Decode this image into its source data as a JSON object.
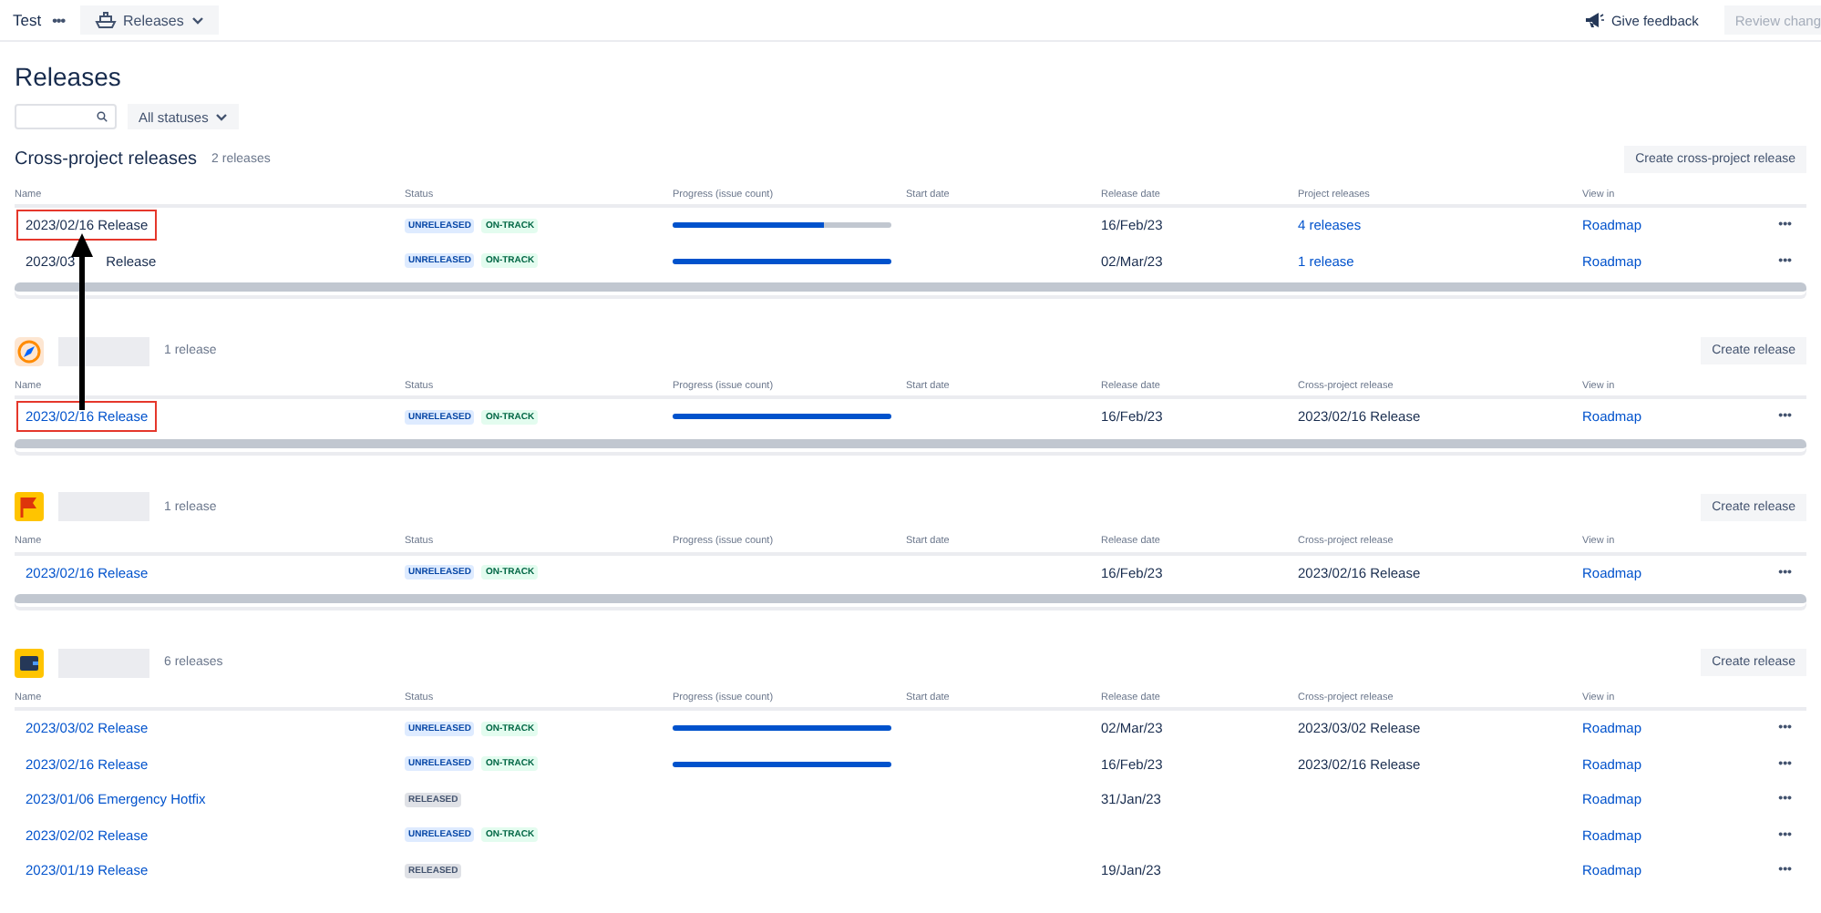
{
  "top_bar": {
    "project": "Test",
    "more": "•••",
    "nav_button": "Releases",
    "feedback": "Give feedback",
    "review_button": {
      "label": "Review chang",
      "disabled": true
    }
  },
  "title": "Releases",
  "filters": {
    "status_dropdown": "All statuses"
  },
  "sections": [
    {
      "kind": "cross_project",
      "heading": "Cross-project releases",
      "count": "2 releases",
      "button": "Create cross-project release",
      "scrollbar": true,
      "columns": [
        "Name",
        "Status",
        "Progress (issue count)",
        "Start date",
        "Release date",
        "Project releases",
        "View in"
      ],
      "rows": [
        {
          "name": "2023/02/16 Release",
          "link": false,
          "highlighted": true,
          "lozenges": [
            {
              "text": "UNRELEASED",
              "kind": "unreleased"
            },
            {
              "text": "ON-TRACK",
              "kind": "ontrack"
            }
          ],
          "progress": {
            "level": 0.69
          },
          "release_date": "16/Feb/23",
          "column_6": {
            "text": "4 releases",
            "link": true
          },
          "view_in": "Roadmap",
          "more": "•••"
        },
        {
          "name_fragments": [
            "2023/03",
            "Release"
          ],
          "link": false,
          "highlighted": false,
          "lozenges": [
            {
              "text": "UNRELEASED",
              "kind": "unreleased"
            },
            {
              "text": "ON-TRACK",
              "kind": "ontrack"
            }
          ],
          "progress": {
            "level": 1
          },
          "release_date": "02/Mar/23",
          "column_6": {
            "text": "1 release",
            "link": true
          },
          "view_in": "Roadmap",
          "more": "•••"
        }
      ]
    },
    {
      "kind": "project",
      "count": "1 release",
      "button": "Create release",
      "scrollbar": true,
      "columns": [
        "Name",
        "Status",
        "Progress (issue count)",
        "Start date",
        "Release date",
        "Cross-project release",
        "View in"
      ],
      "rows": [
        {
          "name": "2023/02/16 Release",
          "link": true,
          "highlighted": true,
          "lozenges": [
            {
              "text": "UNRELEASED",
              "kind": "unreleased"
            },
            {
              "text": "ON-TRACK",
              "kind": "ontrack"
            }
          ],
          "progress": {
            "level": 1
          },
          "release_date": "16/Feb/23",
          "column_6": {
            "text": "2023/02/16 Release",
            "link": false
          },
          "view_in": "Roadmap",
          "more": "•••"
        }
      ]
    },
    {
      "kind": "project",
      "count": "1 release",
      "button": "Create release",
      "scrollbar": true,
      "columns": [
        "Name",
        "Status",
        "Progress (issue count)",
        "Start date",
        "Release date",
        "Cross-project release",
        "View in"
      ],
      "rows": [
        {
          "name": "2023/02/16 Release",
          "link": true,
          "highlighted": false,
          "lozenges": [
            {
              "text": "UNRELEASED",
              "kind": "unreleased"
            },
            {
              "text": "ON-TRACK",
              "kind": "ontrack"
            }
          ],
          "release_date": "16/Feb/23",
          "column_6": {
            "text": "2023/02/16 Release",
            "link": false
          },
          "view_in": "Roadmap",
          "more": "•••"
        }
      ]
    },
    {
      "kind": "project",
      "count": "6 releases",
      "button": "Create release",
      "scrollbar": false,
      "columns": [
        "Name",
        "Status",
        "Progress (issue count)",
        "Start date",
        "Release date",
        "Cross-project release",
        "View in"
      ],
      "rows": [
        {
          "name": "2023/03/02 Release",
          "link": true,
          "highlighted": false,
          "lozenges": [
            {
              "text": "UNRELEASED",
              "kind": "unreleased"
            },
            {
              "text": "ON-TRACK",
              "kind": "ontrack"
            }
          ],
          "progress": {
            "level": 1
          },
          "release_date": "02/Mar/23",
          "column_6": {
            "text": "2023/03/02 Release",
            "link": false
          },
          "view_in": "Roadmap",
          "more": "•••"
        },
        {
          "name": "2023/02/16 Release",
          "link": true,
          "highlighted": false,
          "lozenges": [
            {
              "text": "UNRELEASED",
              "kind": "unreleased"
            },
            {
              "text": "ON-TRACK",
              "kind": "ontrack"
            }
          ],
          "progress": {
            "level": 1
          },
          "release_date": "16/Feb/23",
          "column_6": {
            "text": "2023/02/16 Release",
            "link": false
          },
          "view_in": "Roadmap",
          "more": "•••"
        },
        {
          "name": "2023/01/06 Emergency Hotfix",
          "link": true,
          "highlighted": false,
          "lozenges": [
            {
              "text": "RELEASED",
              "kind": "released"
            }
          ],
          "release_date": "31/Jan/23",
          "view_in": "Roadmap",
          "more": "•••"
        },
        {
          "name": "2023/02/02 Release",
          "link": true,
          "highlighted": false,
          "lozenges": [
            {
              "text": "UNRELEASED",
              "kind": "unreleased"
            },
            {
              "text": "ON-TRACK",
              "kind": "ontrack"
            }
          ],
          "view_in": "Roadmap",
          "more": "•••"
        },
        {
          "name": "2023/01/19 Release",
          "link": true,
          "highlighted": false,
          "lozenges": [
            {
              "text": "RELEASED",
              "kind": "released"
            }
          ],
          "release_date": "19/Jan/23",
          "view_in": "Roadmap",
          "more": "•••"
        }
      ]
    }
  ],
  "annotation": {
    "kind": "arrow"
  }
}
